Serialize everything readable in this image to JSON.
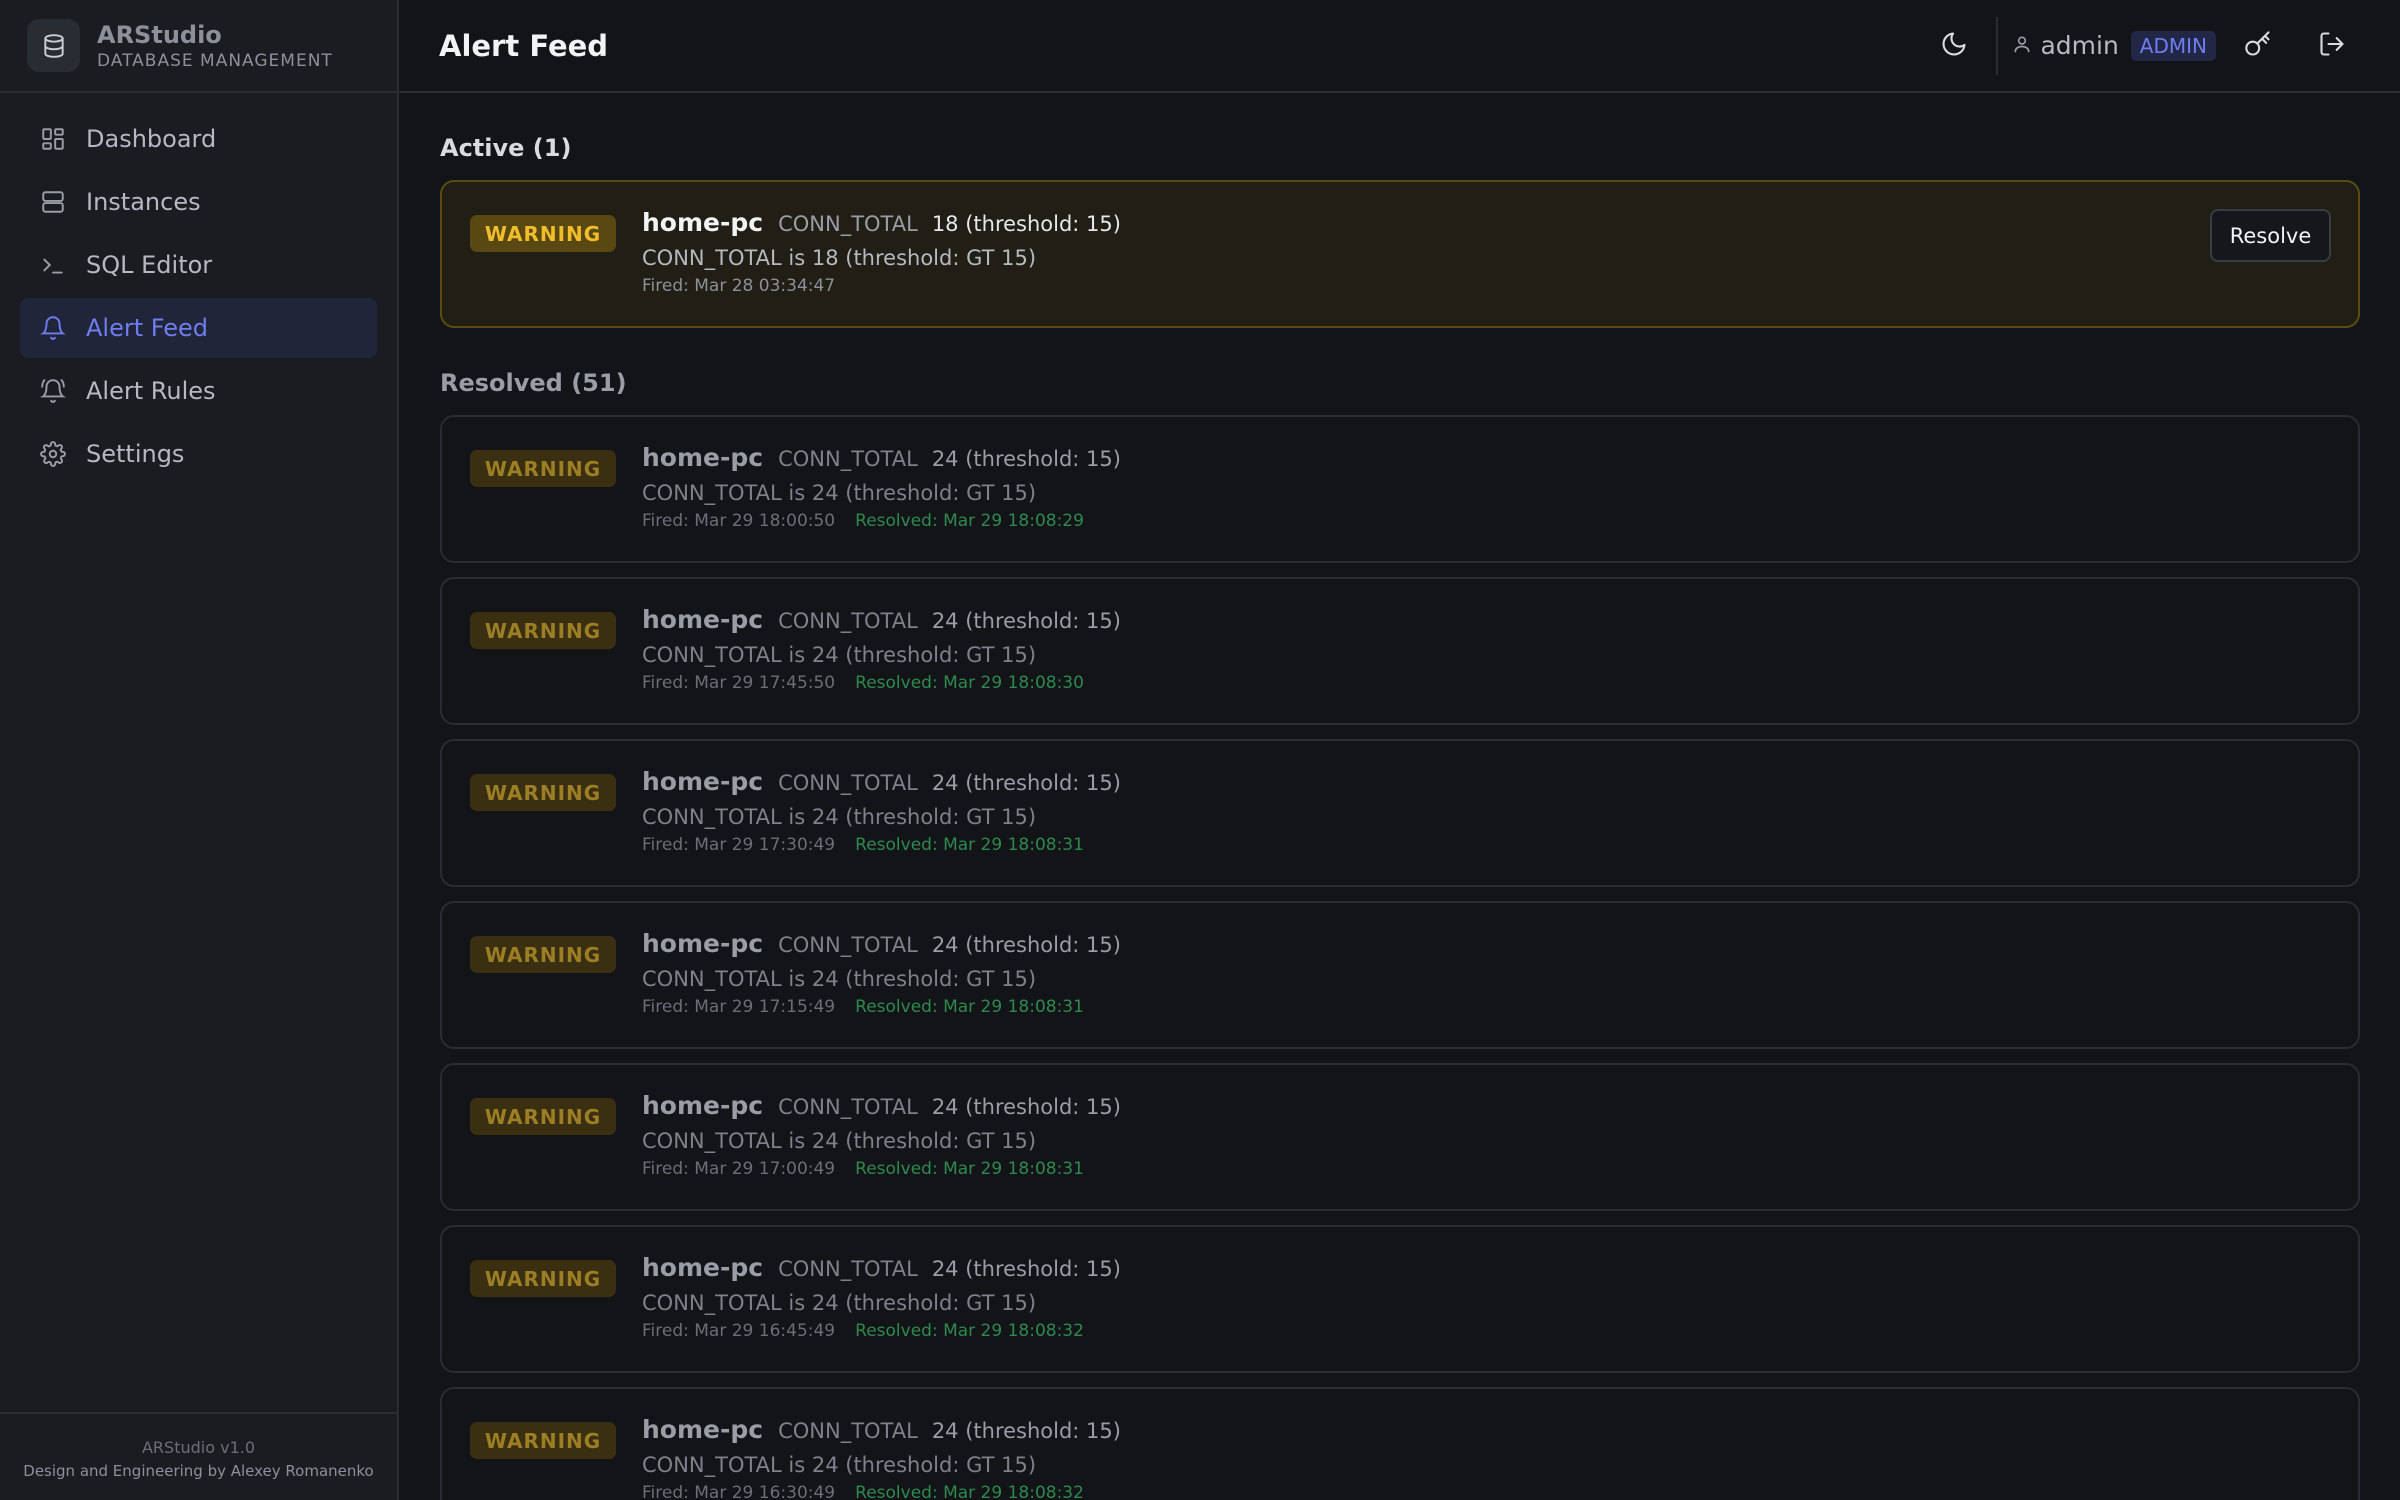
{
  "app": {
    "name": "ARStudio",
    "subtitle": "DATABASE MANAGEMENT",
    "version": "ARStudio v1.0",
    "credit": "Design and Engineering by Alexey Romanenko"
  },
  "sidebar": {
    "items": [
      {
        "label": "Dashboard",
        "icon": "dashboard-icon",
        "active": false
      },
      {
        "label": "Instances",
        "icon": "server-icon",
        "active": false
      },
      {
        "label": "SQL Editor",
        "icon": "terminal-icon",
        "active": false
      },
      {
        "label": "Alert Feed",
        "icon": "bell-icon",
        "active": true
      },
      {
        "label": "Alert Rules",
        "icon": "bell-ring-icon",
        "active": false
      },
      {
        "label": "Settings",
        "icon": "gear-icon",
        "active": false
      }
    ]
  },
  "header": {
    "title": "Alert Feed",
    "user": "admin",
    "role": "ADMIN"
  },
  "active": {
    "title": "Active (1)",
    "alerts": [
      {
        "severity": "WARNING",
        "host": "home-pc",
        "metric": "CONN_TOTAL",
        "value": "18 (threshold: 15)",
        "message": "CONN_TOTAL is 18 (threshold: GT 15)",
        "fired": "Fired: Mar 28 03:34:47",
        "action": "Resolve"
      }
    ]
  },
  "resolved": {
    "title": "Resolved (51)",
    "alerts": [
      {
        "severity": "WARNING",
        "host": "home-pc",
        "metric": "CONN_TOTAL",
        "value": "24 (threshold: 15)",
        "message": "CONN_TOTAL is 24 (threshold: GT 15)",
        "fired": "Fired: Mar 29 18:00:50",
        "resolved": "Resolved: Mar 29 18:08:29"
      },
      {
        "severity": "WARNING",
        "host": "home-pc",
        "metric": "CONN_TOTAL",
        "value": "24 (threshold: 15)",
        "message": "CONN_TOTAL is 24 (threshold: GT 15)",
        "fired": "Fired: Mar 29 17:45:50",
        "resolved": "Resolved: Mar 29 18:08:30"
      },
      {
        "severity": "WARNING",
        "host": "home-pc",
        "metric": "CONN_TOTAL",
        "value": "24 (threshold: 15)",
        "message": "CONN_TOTAL is 24 (threshold: GT 15)",
        "fired": "Fired: Mar 29 17:30:49",
        "resolved": "Resolved: Mar 29 18:08:31"
      },
      {
        "severity": "WARNING",
        "host": "home-pc",
        "metric": "CONN_TOTAL",
        "value": "24 (threshold: 15)",
        "message": "CONN_TOTAL is 24 (threshold: GT 15)",
        "fired": "Fired: Mar 29 17:15:49",
        "resolved": "Resolved: Mar 29 18:08:31"
      },
      {
        "severity": "WARNING",
        "host": "home-pc",
        "metric": "CONN_TOTAL",
        "value": "24 (threshold: 15)",
        "message": "CONN_TOTAL is 24 (threshold: GT 15)",
        "fired": "Fired: Mar 29 17:00:49",
        "resolved": "Resolved: Mar 29 18:08:31"
      },
      {
        "severity": "WARNING",
        "host": "home-pc",
        "metric": "CONN_TOTAL",
        "value": "24 (threshold: 15)",
        "message": "CONN_TOTAL is 24 (threshold: GT 15)",
        "fired": "Fired: Mar 29 16:45:49",
        "resolved": "Resolved: Mar 29 18:08:32"
      },
      {
        "severity": "WARNING",
        "host": "home-pc",
        "metric": "CONN_TOTAL",
        "value": "24 (threshold: 15)",
        "message": "CONN_TOTAL is 24 (threshold: GT 15)",
        "fired": "Fired: Mar 29 16:30:49",
        "resolved": "Resolved: Mar 29 18:08:32"
      }
    ]
  },
  "colors": {
    "accent": "#6f7df0",
    "warning": "#f0be2a",
    "resolved": "#2d8a4f"
  }
}
